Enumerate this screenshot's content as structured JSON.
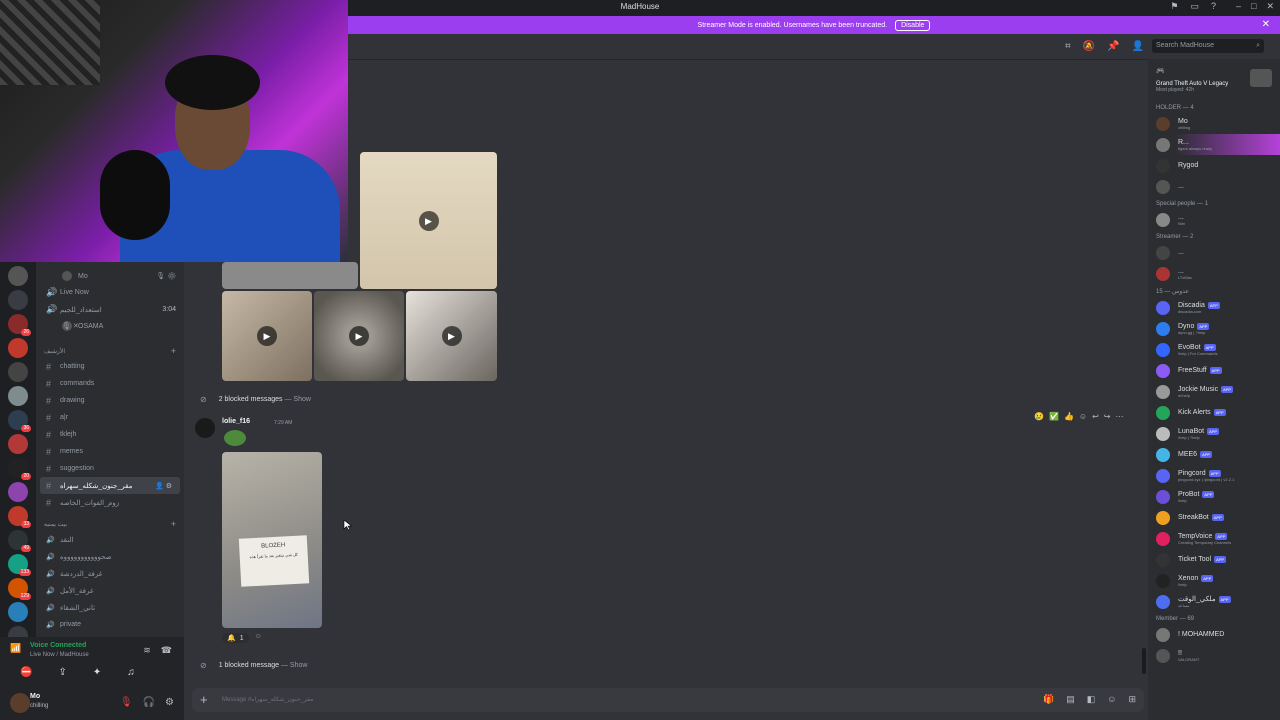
{
  "window": {
    "title": "MadHouse"
  },
  "banner": {
    "text": "Streamer Mode is enabled. Usernames have been truncated.",
    "disable_label": "Disable"
  },
  "header": {
    "search_placeholder": "Search MadHouse"
  },
  "servers": [
    {
      "badge": ""
    },
    {
      "badge": ""
    },
    {
      "badge": "26"
    },
    {
      "badge": ""
    },
    {
      "badge": ""
    },
    {
      "badge": ""
    },
    {
      "badge": "36"
    },
    {
      "badge": ""
    },
    {
      "badge": "20"
    },
    {
      "badge": ""
    },
    {
      "badge": "33"
    },
    {
      "badge": "49"
    },
    {
      "badge": "133"
    },
    {
      "badge": "129"
    },
    {
      "badge": ""
    },
    {
      "badge": "18"
    },
    {
      "badge": "NEW"
    }
  ],
  "channels": {
    "voice_users": [
      {
        "name": "Mo",
        "tag": "OL"
      },
      {
        "name": "Live Now",
        "tag": ""
      }
    ],
    "voice_channel": {
      "name": "استعداد_للجيم",
      "time": "3:04"
    },
    "voice_user_osama": {
      "name": "OSAMA",
      "tag": "OL"
    },
    "category_1": "الأرشيف",
    "text_channels": [
      {
        "name": "chatting"
      },
      {
        "name": "commands"
      },
      {
        "name": "drawing"
      },
      {
        "name": "a|r"
      },
      {
        "name": "tklejh"
      },
      {
        "name": "memes"
      },
      {
        "name": "suggestion"
      },
      {
        "name": "مقر_جنون_شكله_سهراه"
      },
      {
        "name": "زوم_الفوات_الخاصه"
      }
    ],
    "category_2": "بيت يمنيه",
    "voice_channels": [
      {
        "name": "النقد"
      },
      {
        "name": "صحوووووووووووه"
      },
      {
        "name": "غرفة_الدردشة"
      },
      {
        "name": "غرفة_الأمل"
      },
      {
        "name": "ثاني_الشقاء"
      },
      {
        "name": "private"
      }
    ]
  },
  "voice": {
    "status": "Voice Connected",
    "location": "Live Now / MadHouse"
  },
  "user": {
    "name": "Mo",
    "status": "chilling"
  },
  "chat": {
    "blocked_1": {
      "text": "2 blocked messages",
      "dash": " — ",
      "show": "Show"
    },
    "message": {
      "author": "lolie_f16",
      "time": "7:29 AM",
      "photo_text": "BLOZEH",
      "photo_sub": "كل شي بيتغير بعد ما تقرأ هذه"
    },
    "reactions": [
      {
        "emoji": "🔔",
        "count": "1"
      }
    ],
    "blocked_2": {
      "text": "1 blocked message",
      "dash": " — ",
      "show": "Show"
    },
    "composer_placeholder": "Message #مقر_جنون_شكله_سهراه"
  },
  "members": {
    "activity": {
      "game": "Grand Theft Auto V Legacy",
      "played": "Most played: 42h"
    },
    "groups": [
      {
        "title": "HOLDER — 4",
        "members": [
          {
            "name": "Mo",
            "sub": "chilling",
            "badge": "",
            "color": "#5b3d2c"
          },
          {
            "name": "R...",
            "sub": "tigers always ready",
            "badge": "",
            "color": "#777"
          },
          {
            "name": "Rygod",
            "sub": "",
            "badge": "",
            "color": "#333"
          },
          {
            "name": "...",
            "sub": "",
            "badge": "",
            "color": "#555"
          }
        ]
      },
      {
        "title": "Special people — 1",
        "members": [
          {
            "name": "...",
            "sub": "Nim",
            "badge": "",
            "color": "#888"
          }
        ]
      },
      {
        "title": "Streamer — 2",
        "members": [
          {
            "name": "...",
            "sub": "",
            "badge": "",
            "color": "#444"
          },
          {
            "name": "...",
            "sub": "LTxMax",
            "badge": "",
            "color": "#a33"
          }
        ]
      },
      {
        "title": "15 — عدوس",
        "members": [
          {
            "name": "Discadia",
            "sub": "discadia.com",
            "badge": "APP",
            "color": "#5865f2"
          },
          {
            "name": "Dyno",
            "sub": "dyno.gg | ?help",
            "badge": "APP",
            "color": "#2d7df0"
          },
          {
            "name": "EvoBot",
            "sub": "!help | For Commands",
            "badge": "APP",
            "color": "#3366ff"
          },
          {
            "name": "FreeStuff",
            "sub": "",
            "badge": "APP",
            "color": "#8a5cf5"
          },
          {
            "name": "Jockie Music",
            "sub": "m!help",
            "badge": "APP",
            "color": "#999"
          },
          {
            "name": "Kick Alerts",
            "sub": "",
            "badge": "APP",
            "color": "#23a55a"
          },
          {
            "name": "LunaBot",
            "sub": "/help | ?help",
            "badge": "APP",
            "color": "#bbb"
          },
          {
            "name": "MEE6",
            "sub": "",
            "badge": "APP",
            "color": "#45b5e8"
          },
          {
            "name": "Pingcord",
            "sub": "pingcord.xyz | /pingcord | v2.2.1",
            "badge": "APP",
            "color": "#5865f2"
          },
          {
            "name": "ProBot",
            "sub": "/help",
            "badge": "APP",
            "color": "#6b4fd8"
          },
          {
            "name": "StreakBot",
            "sub": "",
            "badge": "APP",
            "color": "#f0a020"
          },
          {
            "name": "TempVoice",
            "sub": "Creating Temporary Channels",
            "badge": "APP",
            "color": "#e02060"
          },
          {
            "name": "Ticket Tool",
            "sub": "",
            "badge": "APP",
            "color": "#333"
          },
          {
            "name": "Xenon",
            "sub": "/help",
            "badge": "APP",
            "color": "#222"
          },
          {
            "name": "ملكي_الوقت",
            "sub": "مساعد",
            "badge": "APP",
            "color": "#4e6ef2"
          }
        ]
      },
      {
        "title": "Member — 69",
        "members": [
          {
            "name": "! MOHAMMED",
            "sub": "",
            "badge": "",
            "color": "#777"
          },
          {
            "name": "!!",
            "sub": "VALORANT",
            "badge": "",
            "color": "#555"
          }
        ]
      }
    ]
  },
  "colors": {
    "accent": "#9b3ef0",
    "background": "#313338",
    "sidebar": "#2b2d31",
    "online": "#23a55a"
  }
}
